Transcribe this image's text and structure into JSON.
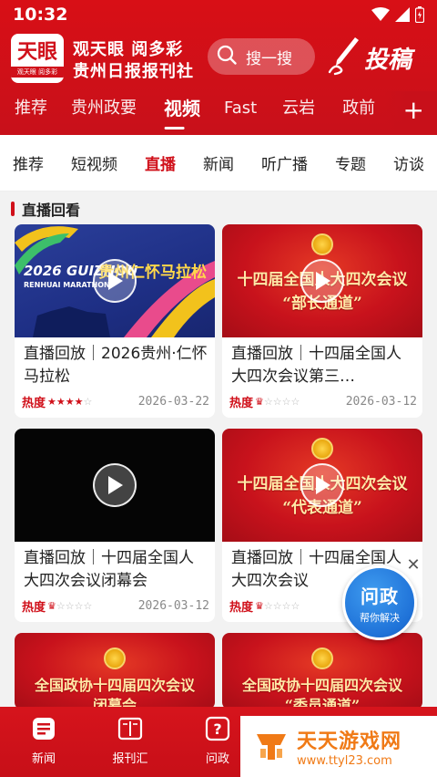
{
  "status_bar": {
    "time": "10:32"
  },
  "header": {
    "logo_main": "天眼",
    "logo_sub": "观天眼 阅多彩",
    "brand_top": "观天眼 阅多彩",
    "brand_bottom": "贵州日报报刊社",
    "search_label": "搜一搜",
    "submit_label": "投稿"
  },
  "main_tabs": [
    {
      "label": "推荐"
    },
    {
      "label": "贵州政要"
    },
    {
      "label": "视频"
    },
    {
      "label": "Fast"
    },
    {
      "label": "云岩"
    },
    {
      "label": "政前"
    }
  ],
  "sub_tabs": [
    {
      "label": "推荐"
    },
    {
      "label": "短视频"
    },
    {
      "label": "直播"
    },
    {
      "label": "新闻"
    },
    {
      "label": "听广播"
    },
    {
      "label": "专题"
    },
    {
      "label": "访谈"
    }
  ],
  "section": {
    "title": "直播回看"
  },
  "cards": [
    {
      "title": "直播回放｜2026贵州·仁怀马拉松",
      "heat": "热度",
      "stars": 4,
      "date": "2026-03-22",
      "thumb_en": "2026 GUIZHOU",
      "thumb_en2": "RENHUAI MARATHON",
      "thumb_cn": "贵州仁怀马拉松"
    },
    {
      "title": "直播回放｜十四届全国人大四次会议第三…",
      "heat": "热度",
      "stars": 1,
      "date": "2026-03-12",
      "thumb_line1": "十四届全国人大四次会议",
      "thumb_line2": "“部长通道”"
    },
    {
      "title": "直播回放｜十四届全国人大四次会议闭幕会",
      "heat": "热度",
      "stars": 1,
      "date": "2026-03-12"
    },
    {
      "title": "直播回放｜十四届全国人大四次会议",
      "heat": "热度",
      "stars": 1,
      "date": "",
      "thumb_line1": "十四届全国人大四次会议",
      "thumb_line2": "“代表通道”"
    },
    {
      "thumb_line1": "全国政协十四届四次会议",
      "thumb_line2": "闭幕会"
    },
    {
      "thumb_line1": "全国政协十四届四次会议",
      "thumb_line2": "“委员通道”"
    }
  ],
  "float_widget": {
    "main": "问政",
    "sub": "帮你解决"
  },
  "bottom_nav": [
    {
      "label": "新闻"
    },
    {
      "label": "报刊汇"
    },
    {
      "label": "问政"
    }
  ],
  "watermark": {
    "main": "天天游戏网",
    "url": "www.ttyl23.com"
  },
  "colors": {
    "brand_red": "#d0101a",
    "float_blue": "#1f72d8",
    "watermark_orange": "#f07a16"
  }
}
